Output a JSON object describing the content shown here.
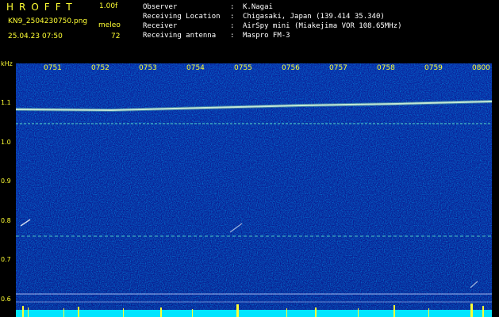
{
  "header": {
    "app_title": "HROFFT",
    "version": "1.00f",
    "filename": "KN9_2504230750.png",
    "datetime": "25.04.23 07:50",
    "meleo_label": "meleo",
    "meleo_value": "72"
  },
  "info": [
    {
      "key": "Observer",
      "value": "K.Nagai"
    },
    {
      "key": "Receiving Location",
      "value": "Chigasaki, Japan (139.414 35.340)"
    },
    {
      "key": "Receiver",
      "value": "AirSpy mini (Miakejima VOR 108.65MHz)"
    },
    {
      "key": "Receiving antenna",
      "value": "Maspro FM-3"
    }
  ],
  "axis": {
    "unit": "kHz",
    "y_ticks": [
      "1.1",
      "1.0",
      "0.9",
      "0.8",
      "0.7",
      "0.6"
    ],
    "x_ticks": [
      "0751",
      "0752",
      "0753",
      "0754",
      "0755",
      "0756",
      "0757",
      "0758",
      "0759",
      "0800"
    ]
  },
  "colors": {
    "text_yellow": "#ffff33",
    "background": "#000000",
    "waterfall_base": "#0a1a8c",
    "carrier_line": "#4fd1c5"
  }
}
